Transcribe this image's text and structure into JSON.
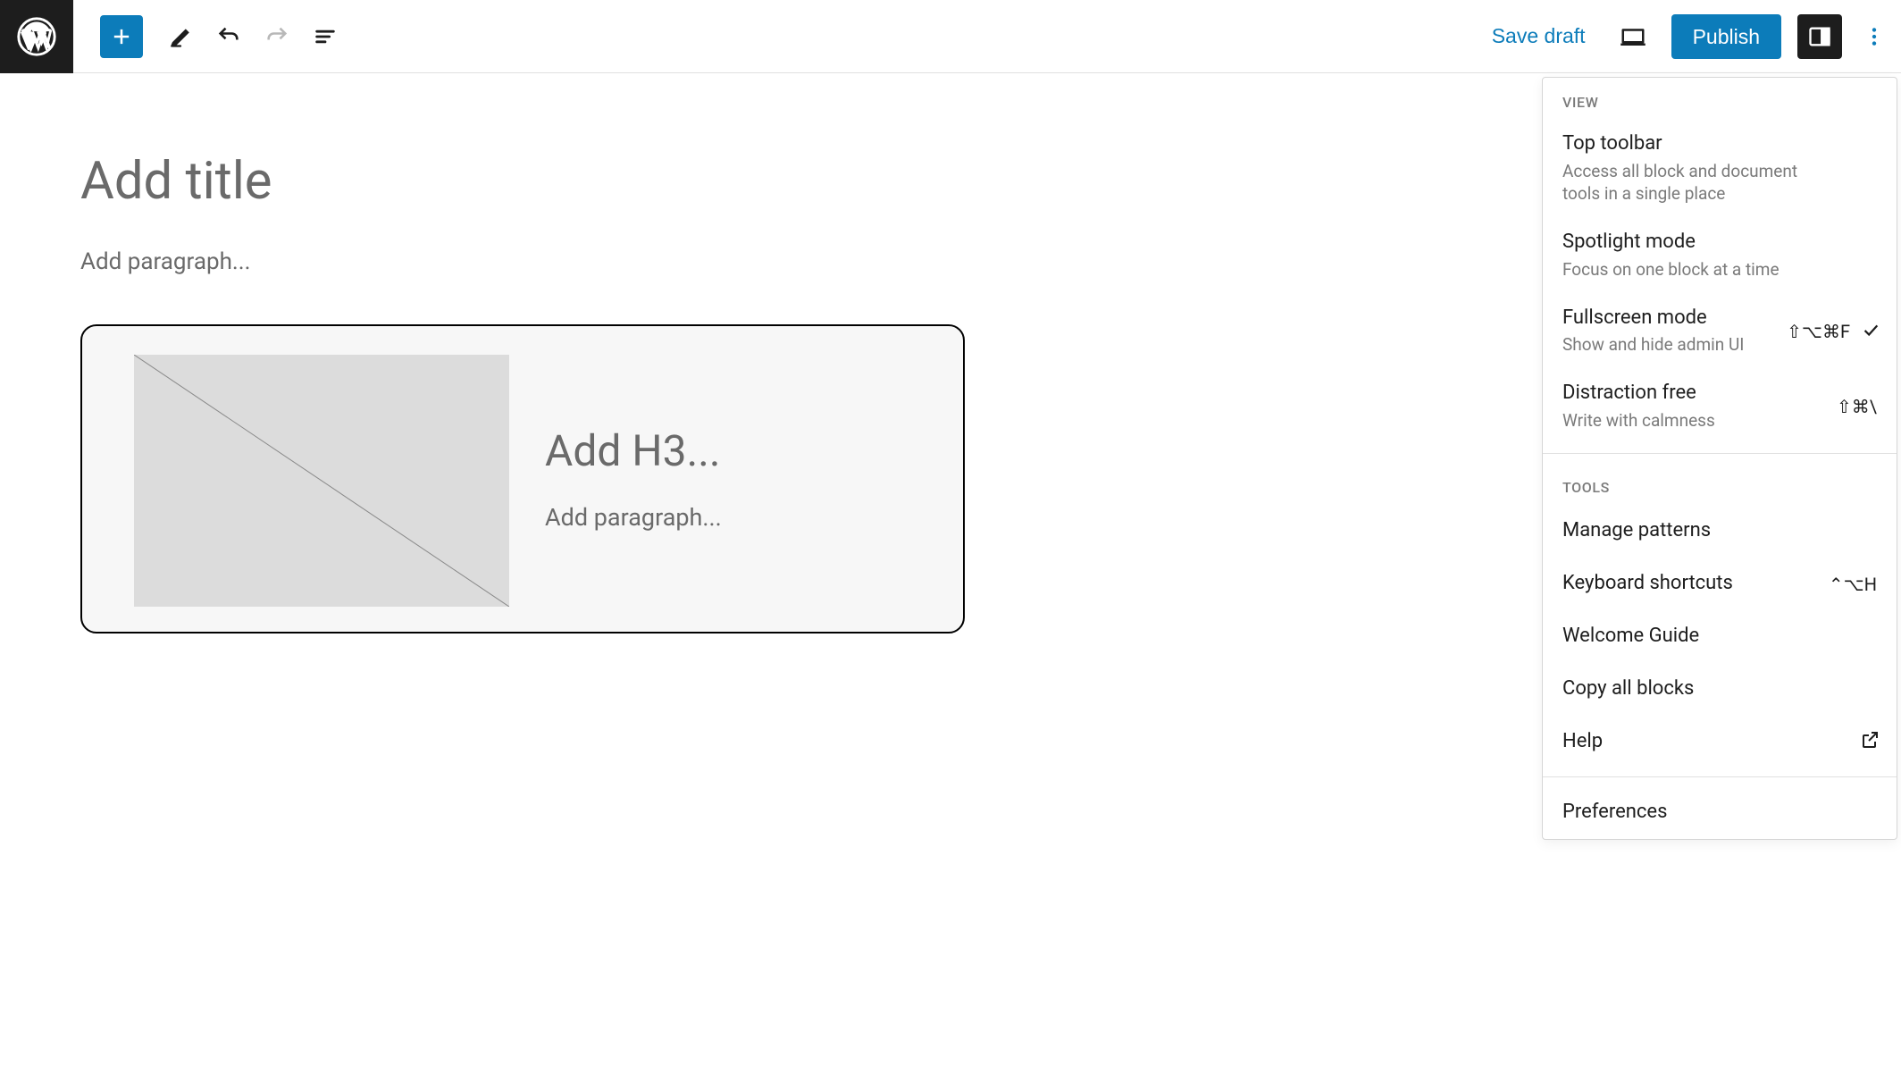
{
  "toolbar": {
    "save_draft_label": "Save draft",
    "publish_label": "Publish"
  },
  "editor": {
    "title_placeholder": "Add title",
    "paragraph_placeholder": "Add paragraph...",
    "media_text": {
      "heading_placeholder": "Add H3...",
      "paragraph_placeholder": "Add paragraph..."
    }
  },
  "options_menu": {
    "sections": {
      "view_label": "VIEW",
      "tools_label": "TOOLS"
    },
    "view_items": [
      {
        "title": "Top toolbar",
        "desc": "Access all block and document tools in a single place",
        "shortcut": "",
        "checked": false
      },
      {
        "title": "Spotlight mode",
        "desc": "Focus on one block at a time",
        "shortcut": "",
        "checked": false
      },
      {
        "title": "Fullscreen mode",
        "desc": "Show and hide admin UI",
        "shortcut": "⇧⌥⌘F",
        "checked": true
      },
      {
        "title": "Distraction free",
        "desc": "Write with calmness",
        "shortcut": "⇧⌘\\",
        "checked": false
      }
    ],
    "tools_items": [
      {
        "title": "Manage patterns",
        "shortcut": "",
        "external": false
      },
      {
        "title": "Keyboard shortcuts",
        "shortcut": "⌃⌥H",
        "external": false
      },
      {
        "title": "Welcome Guide",
        "shortcut": "",
        "external": false
      },
      {
        "title": "Copy all blocks",
        "shortcut": "",
        "external": false
      },
      {
        "title": "Help",
        "shortcut": "",
        "external": true
      }
    ],
    "preferences_label": "Preferences"
  }
}
